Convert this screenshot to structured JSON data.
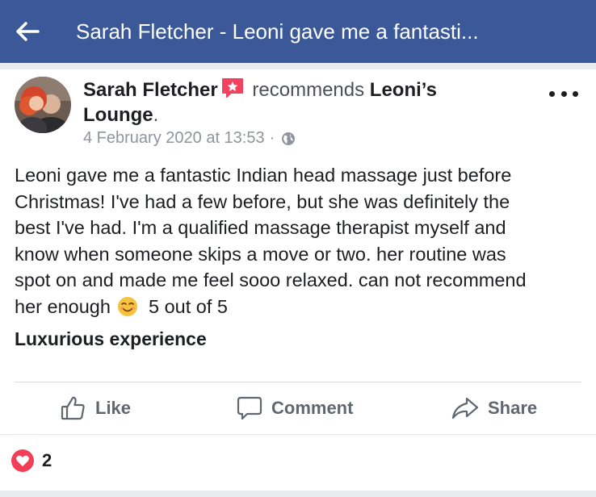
{
  "header": {
    "back_icon": "back-arrow-icon",
    "title": "Sarah Fletcher - Leoni gave me a fantasti..."
  },
  "post": {
    "author": "Sarah Fletcher",
    "recommend_icon": "recommendation-star-icon",
    "action_text": "recommends",
    "page_name_line1": "Leoni’s",
    "page_name_line2": "Lounge",
    "period": ".",
    "timestamp": "4 February 2020 at 13:53",
    "separator": "·",
    "privacy_icon": "globe-icon",
    "more_icon": "more-options-icon",
    "body_line1": "Leoni gave me a fantastic Indian head massage just before",
    "body_line2": "Christmas! I've had a few before, but she was definitely the",
    "body_line3": "best I've had. I'm a qualified massage therapist myself and",
    "body_line4": "know when someone skips a move or two. her routine was",
    "body_line5": "spot on and made me feel sooo relaxed. can not recommend",
    "body_line6_start": "her enough",
    "emoji": "smiling-face-icon",
    "body_line6_end": "5 out of 5",
    "review_title": "Luxurious experience"
  },
  "actions": {
    "like_label": "Like",
    "comment_label": "Comment",
    "share_label": "Share"
  },
  "reactions": {
    "icon": "love-reaction-icon",
    "count": "2"
  },
  "colors": {
    "header_bg": "#3b5998",
    "action_gray": "#606770",
    "love_red": "#f33e58"
  }
}
